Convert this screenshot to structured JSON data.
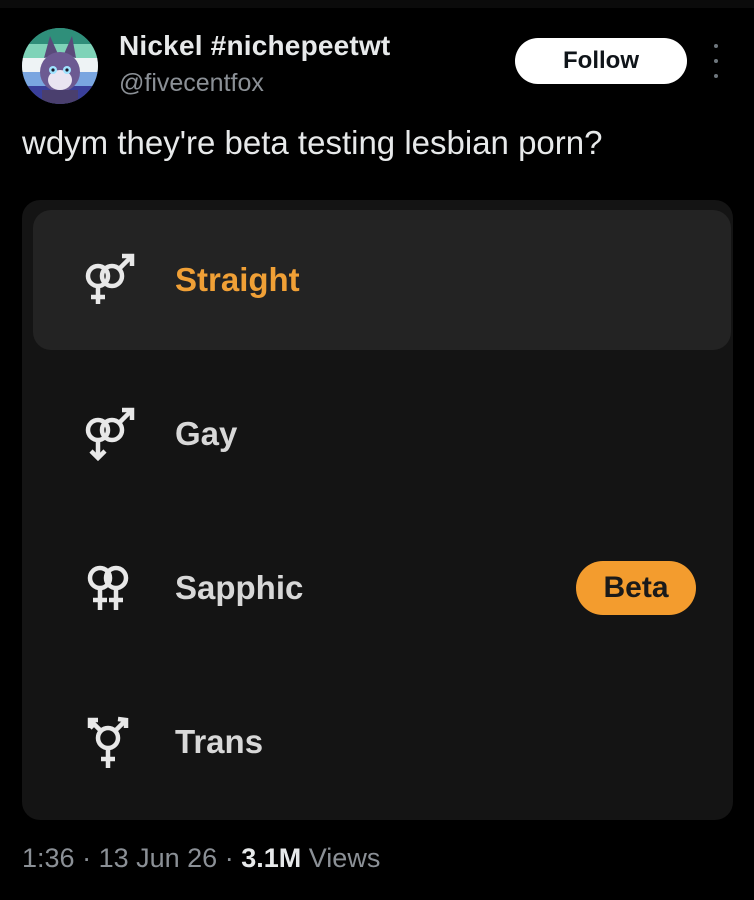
{
  "tweet": {
    "author": {
      "display_name": "Nickel #nichepeetwt",
      "handle": "@fivecentfox",
      "avatar_icon": "avatar-fox-art"
    },
    "follow_label": "Follow",
    "more_icon": "more-vertical-icon",
    "text": "wdym they're beta testing lesbian porn?",
    "time": "1:36",
    "separator": "·",
    "date": "13 Jun 26",
    "views_count": "3.1M",
    "views_label": "Views"
  },
  "media": {
    "options": [
      {
        "label": "Straight",
        "icon": "straight-symbol-icon",
        "selected": true
      },
      {
        "label": "Gay",
        "icon": "gay-symbol-icon",
        "selected": false
      },
      {
        "label": "Sapphic",
        "icon": "sapphic-symbol-icon",
        "selected": false,
        "badge": "Beta"
      },
      {
        "label": "Trans",
        "icon": "trans-symbol-icon",
        "selected": false
      }
    ]
  },
  "colors": {
    "background": "#000000",
    "card": "#141414",
    "selected_row": "#232323",
    "accent": "#f0a036",
    "badge": "#f39c2e",
    "text_primary": "#e7e9ea",
    "text_secondary": "#8b9096"
  }
}
